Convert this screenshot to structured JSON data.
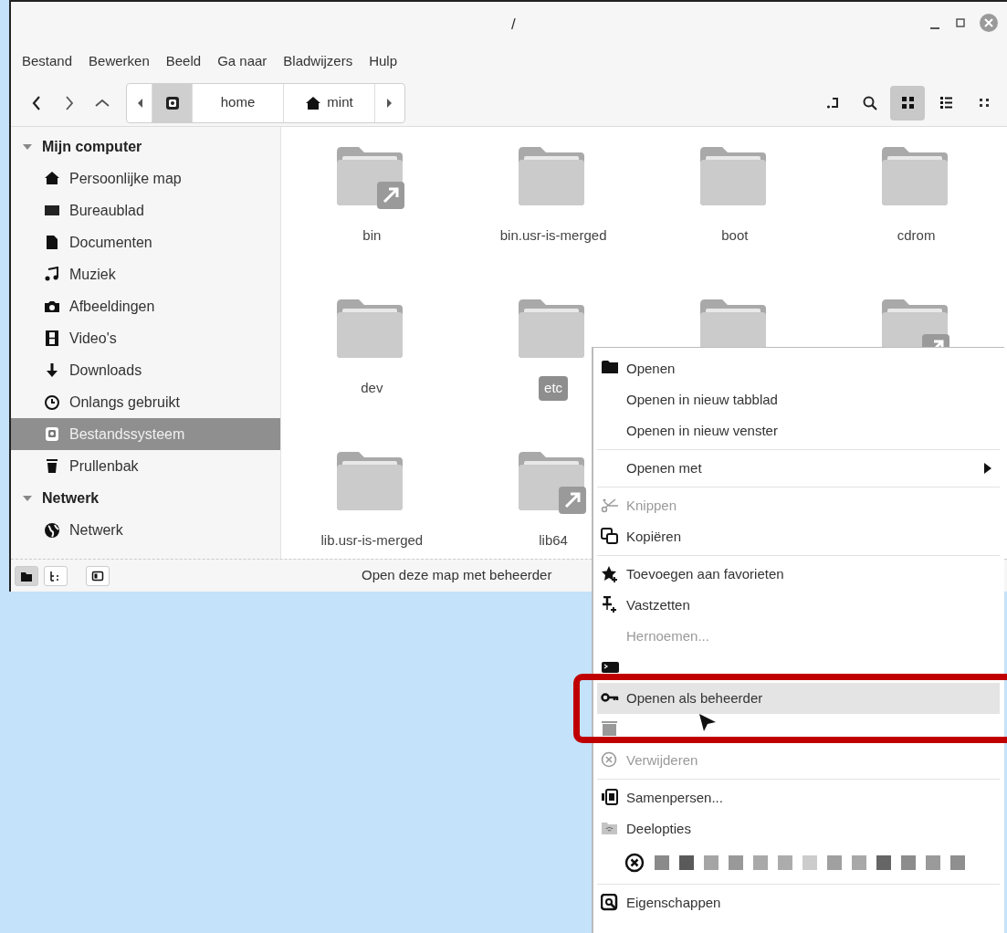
{
  "window": {
    "title": "/"
  },
  "menubar": [
    "Bestand",
    "Bewerken",
    "Beeld",
    "Ga naar",
    "Bladwijzers",
    "Hulp"
  ],
  "path_bar": [
    {
      "selected": true
    },
    {
      "label": "home",
      "selected": false
    },
    {
      "label": "mint",
      "selected": false
    }
  ],
  "view_buttons": [
    {
      "selected": true
    },
    {
      "selected": false
    },
    {
      "selected": false
    }
  ],
  "sidebar": [
    {
      "label": "Mijn computer",
      "expanded": true,
      "children": [
        {
          "label": "Persoonlijke map",
          "selected": false
        },
        {
          "label": "Bureaublad",
          "selected": false
        },
        {
          "label": "Documenten",
          "selected": false
        },
        {
          "label": "Muziek",
          "selected": false
        },
        {
          "label": "Afbeeldingen",
          "selected": false
        },
        {
          "label": "Video's",
          "selected": false
        },
        {
          "label": "Downloads",
          "selected": false
        },
        {
          "label": "Onlangs gebruikt",
          "selected": false
        },
        {
          "label": "Bestandssysteem",
          "selected": true
        },
        {
          "label": "Prullenbak",
          "selected": false
        }
      ]
    },
    {
      "label": "Netwerk",
      "expanded": true,
      "children": [
        {
          "label": "Netwerk",
          "selected": false
        }
      ]
    }
  ],
  "files": [
    {
      "name": "bin",
      "symlink": true,
      "selected": false
    },
    {
      "name": "bin.usr-is-merged",
      "symlink": false,
      "selected": false
    },
    {
      "name": "boot",
      "symlink": false,
      "selected": false
    },
    {
      "name": "cdrom",
      "symlink": false,
      "selected": false
    },
    {
      "name": "dev",
      "symlink": false,
      "selected": false
    },
    {
      "name": "etc",
      "symlink": false,
      "selected": true
    },
    {
      "symlink": false,
      "selected": false
    },
    {
      "symlink": true,
      "selected": false
    },
    {
      "name": "lib.usr-is-merged",
      "symlink": false,
      "selected": false
    },
    {
      "name": "lib64",
      "symlink": true,
      "selected": false
    }
  ],
  "status_bar": {
    "buttons": [
      {
        "selected": true
      },
      {
        "selected": false
      },
      {
        "selected": false
      }
    ],
    "text": "Open deze map met beheerder"
  },
  "context_menu": [
    {
      "kind": "item",
      "label": "Openen",
      "disabled": false,
      "highlighted": false
    },
    {
      "kind": "item",
      "label": "Openen in nieuw tabblad",
      "disabled": false,
      "highlighted": false
    },
    {
      "kind": "item",
      "label": "Openen in nieuw venster",
      "disabled": false,
      "highlighted": false
    },
    {
      "kind": "separator"
    },
    {
      "kind": "item",
      "label": "Openen met",
      "disabled": false,
      "highlighted": false,
      "submenu": true
    },
    {
      "kind": "separator"
    },
    {
      "kind": "item",
      "label": "Knippen",
      "disabled": true,
      "highlighted": false
    },
    {
      "kind": "item",
      "label": "Kopiëren",
      "disabled": false,
      "highlighted": false
    },
    {
      "kind": "separator"
    },
    {
      "kind": "item",
      "label": "Toevoegen aan favorieten",
      "disabled": false,
      "highlighted": false
    },
    {
      "kind": "item",
      "label": "Vastzetten",
      "disabled": false,
      "highlighted": false
    },
    {
      "kind": "item",
      "label": "Hernoemen...",
      "disabled": true,
      "highlighted": false
    },
    {
      "kind": "item",
      "disabled": false,
      "highlighted": false
    },
    {
      "kind": "item",
      "label": "Openen als beheerder",
      "disabled": false,
      "highlighted": true
    },
    {
      "kind": "item",
      "disabled": true,
      "highlighted": false
    },
    {
      "kind": "item",
      "label": "Verwijderen",
      "disabled": true,
      "highlighted": false
    },
    {
      "kind": "separator"
    },
    {
      "kind": "item",
      "label": "Samenpersen...",
      "disabled": false,
      "highlighted": false
    },
    {
      "kind": "item",
      "label": "Deelopties",
      "disabled": false,
      "highlighted": false
    },
    {
      "kind": "colors",
      "colors": [
        {
          "color": "#8a8a8a"
        },
        {
          "color": "#5a5a5a"
        },
        {
          "color": "#a5a5a5"
        },
        {
          "color": "#999999"
        },
        {
          "color": "#a9a9a9"
        },
        {
          "color": "#acacac"
        },
        {
          "color": "#cccccc"
        },
        {
          "color": "#a0a0a0"
        },
        {
          "color": "#a8a8a8"
        },
        {
          "color": "#666666"
        },
        {
          "color": "#8c8c8c"
        },
        {
          "color": "#9a9a9a"
        },
        {
          "color": "#8f8f8f"
        }
      ]
    },
    {
      "kind": "separator"
    },
    {
      "kind": "item",
      "label": "Eigenschappen",
      "disabled": false,
      "highlighted": false
    }
  ]
}
